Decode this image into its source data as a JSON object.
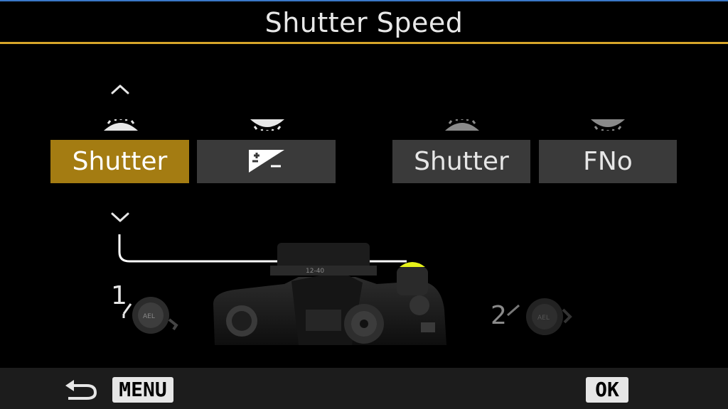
{
  "header": {
    "title": "Shutter Speed"
  },
  "groups": [
    {
      "options": [
        {
          "label": "Shutter",
          "selected": true
        },
        {
          "label": "",
          "icon": "exposure-compensation-icon",
          "selected": false
        }
      ]
    },
    {
      "options": [
        {
          "label": "Shutter",
          "selected": false
        },
        {
          "label": "FNo",
          "selected": false
        }
      ]
    }
  ],
  "dials": {
    "dial1": "1",
    "dial2": "2"
  },
  "footer": {
    "back_icon": "return-arrow-icon",
    "menu_label": "MENU",
    "ok_label": "OK"
  },
  "colors": {
    "accent": "#a47c12",
    "title_rule": "#d8a62a",
    "highlight_dial": "#e6f21a",
    "option_bg": "#3a3a3a"
  }
}
